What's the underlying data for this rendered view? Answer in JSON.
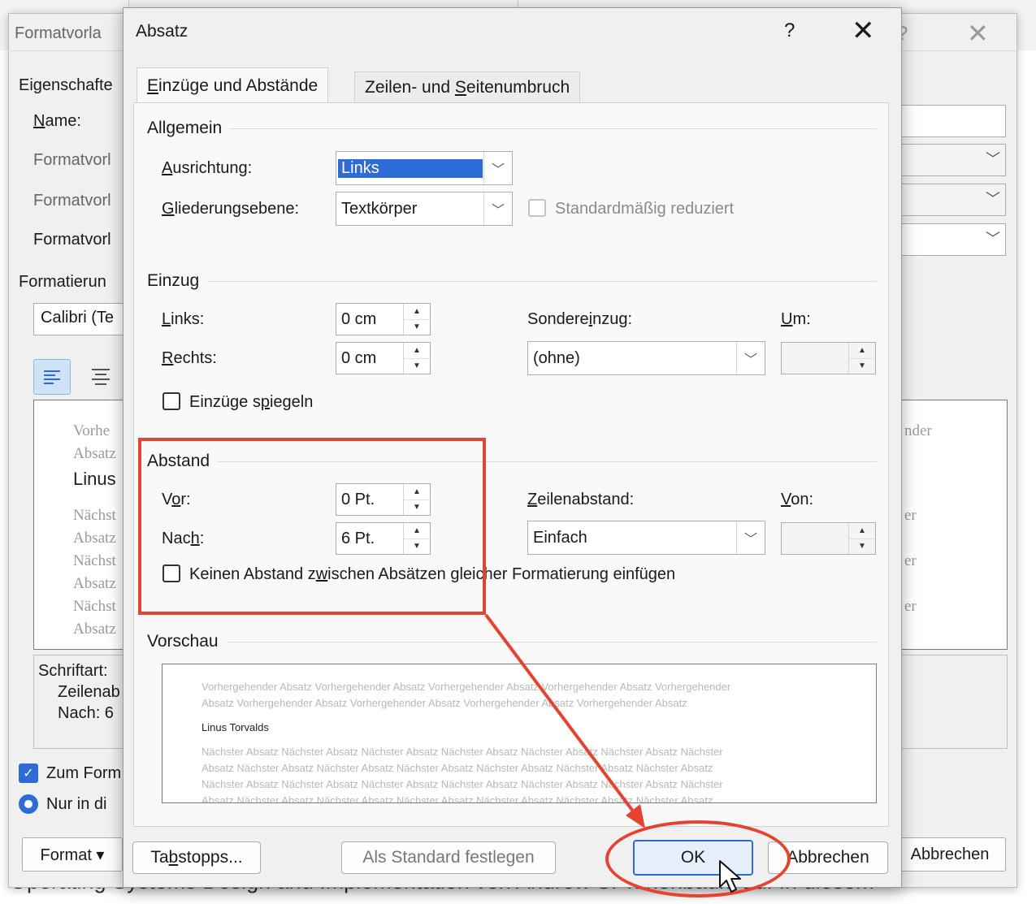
{
  "doc": {
    "bottom_text": "Operating Systems Design and Implementation von Andrew S. Tanenbaum zu. In diesem"
  },
  "back": {
    "title": "Formatvorla",
    "help": "?",
    "close": "✕",
    "properties": "Eigenschafte",
    "name_label": "Name:",
    "type_label": "Formatvorl",
    "based_label": "Formatvorl",
    "next_label": "Formatvorl",
    "formatting": "Formatierun",
    "font": "Calibri (Te",
    "preview_lines": [
      "Vorhe",
      "Absatz",
      "Linus",
      "Nächst",
      "Absatz",
      "Nächst",
      "Absatz",
      "Nächst",
      "Absatz"
    ],
    "preview_right": [
      "nder",
      "er",
      "er",
      "er"
    ],
    "desc_1": "Schriftart:",
    "desc_2": "Zeilenab",
    "desc_3": "Nach:  6",
    "add_to_gallery": "Zum Form",
    "only_in_doc": "Nur in di",
    "format_button": "Format ▾",
    "cancel_button": "Abbrechen"
  },
  "dialog": {
    "title": "Absatz",
    "help": "?",
    "close": "✕",
    "tabs": [
      "Einzüge und Abstände",
      "Zeilen- und Seitenumbruch"
    ],
    "general": {
      "heading": "Allgemein",
      "alignment_label": "Ausrichtung:",
      "alignment_value": "Links",
      "outline_label": "Gliederungsebene:",
      "outline_value": "Textkörper",
      "collapsed_label": "Standardmäßig reduziert"
    },
    "indent": {
      "heading": "Einzug",
      "left_label": "Links:",
      "left_value": "0 cm",
      "right_label": "Rechts:",
      "right_value": "0 cm",
      "special_label": "Sondereinzug:",
      "special_value": "(ohne)",
      "by_label": "Um:",
      "by_value": "",
      "mirror_label": "Einzüge spiegeln"
    },
    "spacing": {
      "heading": "Abstand",
      "before_label": "Vor:",
      "before_value": "0 Pt.",
      "after_label": "Nach:",
      "after_value": "6 Pt.",
      "line_label": "Zeilenabstand:",
      "line_value": "Einfach",
      "at_label": "Von:",
      "at_value": "",
      "no_space_label": "Keinen Abstand zwischen Absätzen gleicher Formatierung einfügen"
    },
    "preview": {
      "heading": "Vorschau",
      "prev_lines": [
        "Vorhergehender Absatz Vorhergehender Absatz Vorhergehender Absatz Vorhergehender Absatz Vorhergehender",
        "Absatz Vorhergehender Absatz Vorhergehender Absatz Vorhergehender Absatz Vorhergehender Absatz"
      ],
      "current": "Linus Torvalds",
      "next_lines": [
        "Nächster Absatz Nächster Absatz Nächster Absatz Nächster Absatz Nächster Absatz Nächster Absatz Nächster",
        "Absatz Nächster Absatz Nächster Absatz Nächster Absatz Nächster Absatz Nächster Absatz Nächster Absatz",
        "Nächster Absatz Nächster Absatz Nächster Absatz Nächster Absatz Nächster Absatz Nächster Absatz Nächster",
        "Absatz Nächster Absatz Nächster Absatz Nächster Absatz Nächster Absatz Nächster Absatz Nächster Absatz"
      ]
    },
    "buttons": {
      "tabs": "Tabstopps...",
      "set_default": "Als Standard festlegen",
      "ok": "OK",
      "cancel": "Abbrechen"
    }
  },
  "annotation": {
    "color": "#e5432f"
  },
  "colors": {
    "accent": "#2f6bd6",
    "checkbox_checked": "#2f6bd6"
  }
}
